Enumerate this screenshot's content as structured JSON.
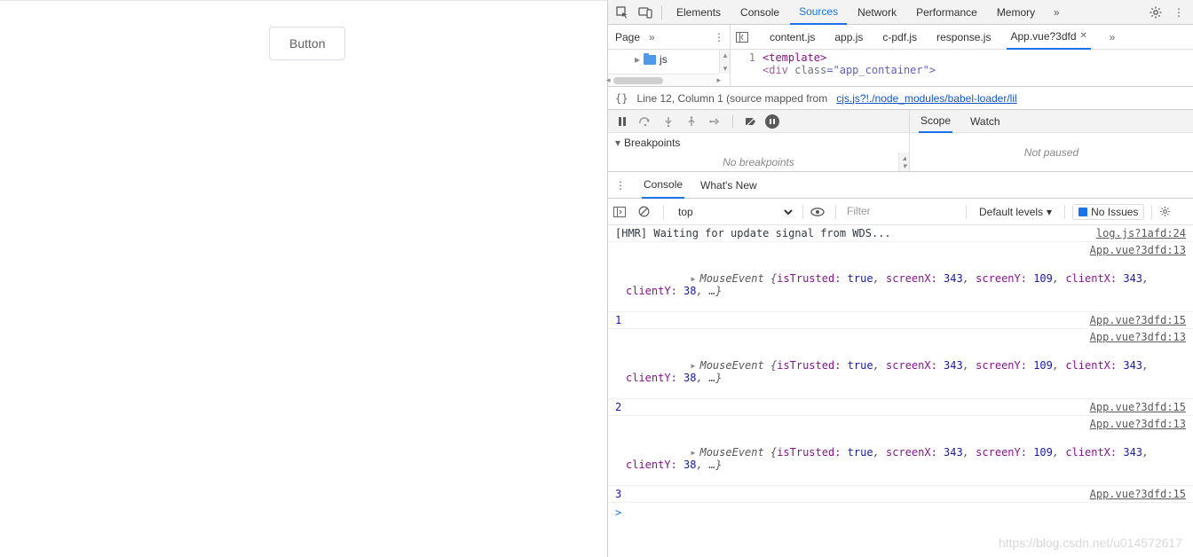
{
  "page": {
    "button_label": "Button"
  },
  "devtools": {
    "tabs": [
      "Elements",
      "Console",
      "Sources",
      "Network",
      "Performance",
      "Memory"
    ],
    "active_tab": "Sources",
    "page_nav_label": "Page",
    "file_tabs": [
      "content.js",
      "app.js",
      "c-pdf.js",
      "response.js",
      "App.vue?3dfd"
    ],
    "active_file": "App.vue?3dfd",
    "tree": {
      "folder": "js"
    },
    "code": {
      "line1_num": "1",
      "line1_text": "<template>",
      "line2_frag1": "<div",
      "line2_frag2": " class",
      "line2_frag3": "=\"app_container\">"
    },
    "status": {
      "prefix": "Line 12, Column 1 (source mapped from ",
      "link": "cjs.js?!./node_modules/babel-loader/lil"
    },
    "breakpoints": {
      "header": "Breakpoints",
      "empty": "No breakpoints"
    },
    "scope_tabs": [
      "Scope",
      "Watch"
    ],
    "scope_body": "Not paused",
    "drawer_tabs": [
      "Console",
      "What's New"
    ],
    "drawer_active": "Console"
  },
  "console_toolbar": {
    "context": "top",
    "filter_placeholder": "Filter",
    "levels": "Default levels",
    "issues": "No Issues"
  },
  "console": {
    "hmr": {
      "text": "[HMR] Waiting for update signal from WDS...",
      "src": "log.js?1afd:24"
    },
    "mouse_event": {
      "head": "MouseEvent",
      "open": " {",
      "k_isTrusted": "isTrusted:",
      "v_true": " true",
      "sep": ", ",
      "k_screenX": "screenX:",
      "v_343": " 343",
      "k_screenY": "screenY:",
      "v_109": " 109",
      "k_clientX": "clientX:",
      "k_clientY": "clientY:",
      "v_38": " 38",
      "tail": ", …}"
    },
    "src13": "App.vue?3dfd:13",
    "src15": "App.vue?3dfd:15",
    "n1": "1",
    "n2": "2",
    "n3": "3",
    "prompt": ">"
  },
  "watermark": "https://blog.csdn.net/u014572617"
}
